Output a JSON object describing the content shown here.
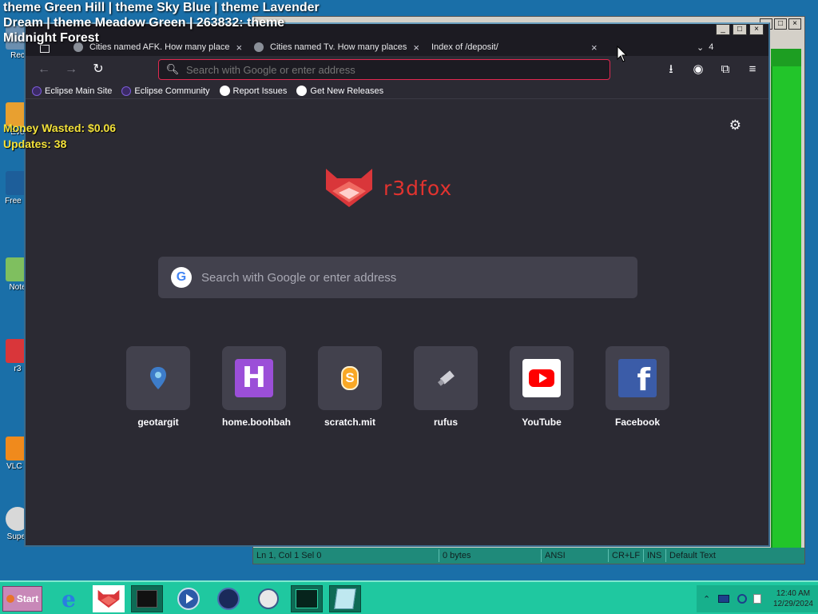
{
  "overlay": {
    "title": "theme Green Hill | theme Sky Blue | theme Lavender Dream | theme Meadow Green | 263832: theme Midnight Forest",
    "money_wasted": "Money Wasted: $0.06",
    "updates": "Updates: 38"
  },
  "desktop_icons": [
    {
      "label": "Rec",
      "icon": "recycle-bin-icon"
    },
    {
      "label": "Eve",
      "icon": "event-icon"
    },
    {
      "label": "Free M",
      "icon": "app-icon"
    },
    {
      "label": "Note",
      "icon": "notepad-icon"
    },
    {
      "label": "r3",
      "icon": "r3dfox-icon"
    },
    {
      "label": "VLC p",
      "icon": "vlc-icon"
    },
    {
      "label": "Super",
      "icon": "app-icon"
    }
  ],
  "browser": {
    "tabs": [
      {
        "title": "Cities named AFK. How many place",
        "close": "×"
      },
      {
        "title": "Cities named Tv. How many places",
        "close": "×"
      },
      {
        "title": "Index of /deposit/",
        "close": "×"
      }
    ],
    "tab_count": "4",
    "url_placeholder": "Search with Google or enter address",
    "bookmarks": [
      {
        "label": "Eclipse Main Site",
        "icon": "eclipse-icon"
      },
      {
        "label": "Eclipse Community",
        "icon": "eclipse-icon"
      },
      {
        "label": "Report Issues",
        "icon": "github-icon"
      },
      {
        "label": "Get New Releases",
        "icon": "github-icon"
      }
    ],
    "brand": "r3dfox",
    "search_placeholder": "Search with Google or enter address",
    "shortcuts": [
      {
        "label": "geotargit",
        "icon": "map-pin-icon"
      },
      {
        "label": "home.boohbah",
        "icon": "letter-h-icon"
      },
      {
        "label": "scratch.mit",
        "icon": "scratch-icon"
      },
      {
        "label": "rufus",
        "icon": "usb-drive-icon"
      },
      {
        "label": "YouTube",
        "icon": "youtube-icon"
      },
      {
        "label": "Facebook",
        "icon": "facebook-icon"
      }
    ]
  },
  "editor_status": {
    "position": "Ln 1, Col 1",
    "sel": "Sel 0",
    "size": "0 bytes",
    "encoding": "ANSI",
    "eol": "CR+LF",
    "mode": "INS",
    "style": "Default Text"
  },
  "taskbar": {
    "start_label": "Start",
    "time": "12:40 AM",
    "date": "12/29/2024"
  },
  "colors": {
    "accent_red": "#e22850",
    "browser_bg": "#2b2a33",
    "taskbar": "#1fc8a0",
    "overlay_yellow": "#f4e23a"
  }
}
